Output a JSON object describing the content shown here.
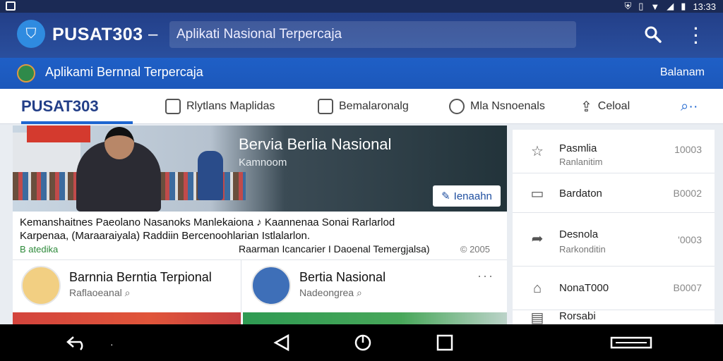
{
  "status": {
    "time": "13:33"
  },
  "appbar": {
    "brand": "PUSAT303",
    "dash": "–",
    "search_value": "Aplikati Nasional Terpercaja"
  },
  "subbar": {
    "title": "Aplikami Bernnal Terpercaja",
    "right": "Balanam"
  },
  "tabs": [
    {
      "label": "PUSAT303",
      "icon": "none",
      "active": true
    },
    {
      "label": "Rlytlans Maplidas",
      "icon": "chat-icon"
    },
    {
      "label": "Bemalaronalg",
      "icon": "message-icon"
    },
    {
      "label": "Mla Nsnoenals",
      "icon": "badge-icon"
    },
    {
      "label": "Celoal",
      "icon": "share-icon"
    }
  ],
  "hero": {
    "title": "Bervia Berlia Nasional",
    "subtitle": "Kamnoom",
    "button": "Ienaahn"
  },
  "article": {
    "line1": "Kemanshaitnes Paeolano Nasanoks Manlekaiona  ♪  Kaannenaa Sonai Rarlarlod",
    "line2": "Karpenaa, (Maraaraiyala) Raddiin  Bercenoohlarian  Istlalarlon.",
    "tag": "B  atedika",
    "meta": "Raarman Icancarier I Daoenal Temergjalsa)",
    "count": "© 2005"
  },
  "cards": [
    {
      "title": "Barnnia Berntia Terpional",
      "subtitle": "Raflaoeanal"
    },
    {
      "title": "Bertia Nasional",
      "subtitle": "Nadeongrea",
      "more": "···"
    }
  ],
  "side": [
    {
      "icon": "star-icon",
      "title": "Pasmlia",
      "subtitle": "Ranlanitim",
      "value": "10003"
    },
    {
      "icon": "bookmark-icon",
      "title": "Bardaton",
      "subtitle": "",
      "value": "B0002"
    },
    {
      "icon": "share-arrow-icon",
      "title": "Desnola",
      "subtitle": "Rarkonditin",
      "value": "'0003"
    },
    {
      "icon": "bank-icon",
      "title": "NonaT000",
      "subtitle": "",
      "value": "B0007"
    },
    {
      "icon": "doc-icon",
      "title": "Rorsabi",
      "subtitle": "",
      "value": ""
    }
  ]
}
